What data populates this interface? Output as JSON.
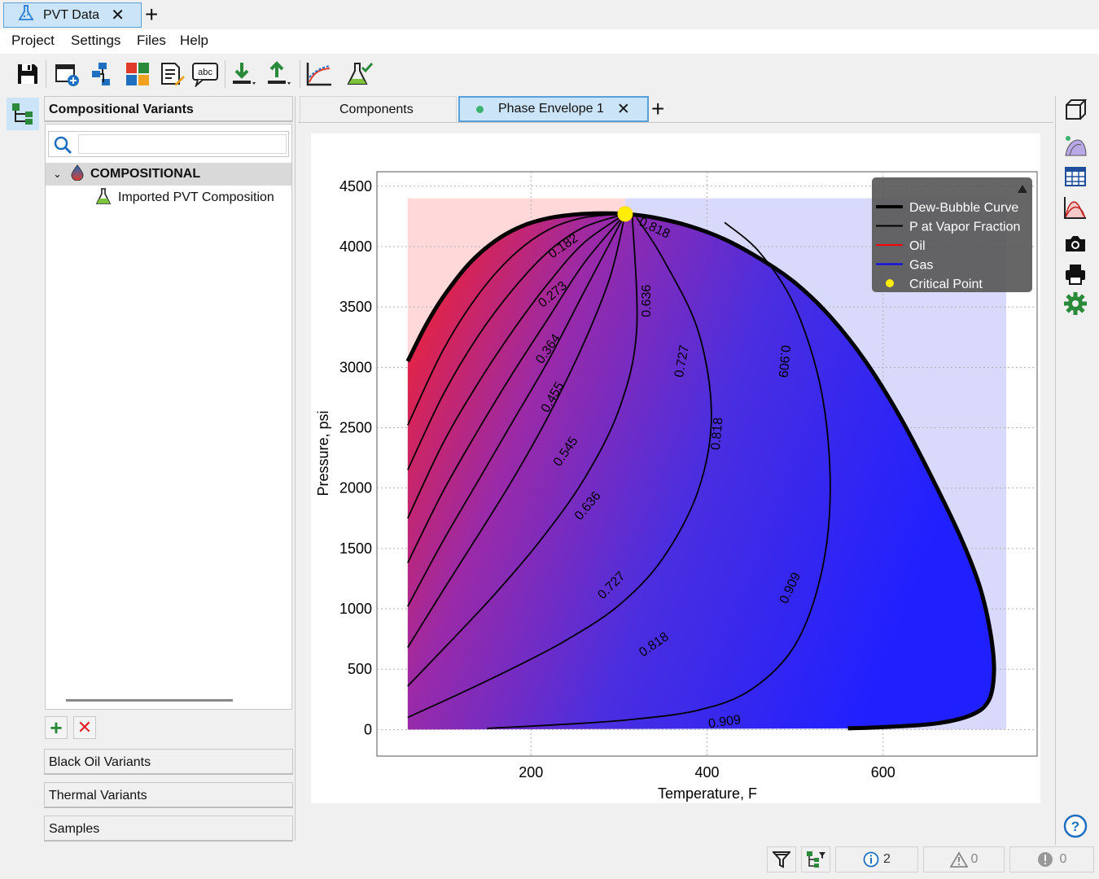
{
  "app_tab": {
    "title": "PVT Data"
  },
  "menu": {
    "items": [
      "Project",
      "Settings",
      "Files",
      "Help"
    ]
  },
  "toolbar": {
    "icons": [
      "save-icon",
      "new-window-icon",
      "hierarchy-icon",
      "puzzle-icon",
      "edit-document-icon",
      "spellcheck-icon",
      "import-icon",
      "export-icon",
      "chart-icon",
      "flask-check-icon"
    ],
    "spell_label": "abc"
  },
  "left_panel": {
    "title": "Compositional Variants",
    "search": {
      "value": "",
      "placeholder": ""
    },
    "tree": {
      "root": "COMPOSITIONAL",
      "children": [
        "Imported PVT Composition"
      ]
    },
    "sections": [
      "Black Oil Variants",
      "Thermal Variants",
      "Samples"
    ]
  },
  "doc_tabs": [
    {
      "label": "Components",
      "active": false
    },
    {
      "label": "Phase Envelope 1",
      "active": true
    }
  ],
  "chart_data": {
    "type": "line",
    "title": "",
    "xlabel": "Temperature, F",
    "ylabel": "Pressure, psi",
    "xlim": [
      25,
      775
    ],
    "ylim": [
      -220,
      4620
    ],
    "xticks": [
      200,
      400,
      600
    ],
    "yticks": [
      0,
      500,
      1000,
      1500,
      2000,
      2500,
      3000,
      3500,
      4000,
      4500
    ],
    "grid": true,
    "legend_position": "top-right",
    "legend": [
      {
        "label": "Dew-Bubble Curve",
        "color": "#000000",
        "kind": "thick-line"
      },
      {
        "label": "P at Vapor Fraction",
        "color": "#000000",
        "kind": "line"
      },
      {
        "label": "Oil",
        "color": "#ff0000",
        "kind": "line"
      },
      {
        "label": "Gas",
        "color": "#0000ff",
        "kind": "line"
      },
      {
        "label": "Critical Point",
        "color": "#ffee00",
        "kind": "marker"
      }
    ],
    "region_fill": {
      "oil": "#ffd9d9",
      "gas": "#d9d9fb",
      "t_min": 60,
      "t_max": 740,
      "p_max": 4400
    },
    "critical_point": {
      "T": 307,
      "P": 4270
    },
    "envelope": [
      [
        60,
        3050
      ],
      [
        80,
        3340
      ],
      [
        100,
        3580
      ],
      [
        130,
        3860
      ],
      [
        160,
        4050
      ],
      [
        190,
        4170
      ],
      [
        220,
        4235
      ],
      [
        250,
        4265
      ],
      [
        280,
        4275
      ],
      [
        307,
        4270
      ],
      [
        340,
        4240
      ],
      [
        380,
        4170
      ],
      [
        420,
        4060
      ],
      [
        460,
        3900
      ],
      [
        500,
        3700
      ],
      [
        540,
        3420
      ],
      [
        580,
        3050
      ],
      [
        620,
        2580
      ],
      [
        660,
        2020
      ],
      [
        690,
        1560
      ],
      [
        710,
        1180
      ],
      [
        722,
        800
      ],
      [
        726,
        480
      ],
      [
        720,
        240
      ],
      [
        700,
        120
      ],
      [
        660,
        50
      ],
      [
        600,
        20
      ],
      [
        560,
        10
      ]
    ],
    "quality_lines": [
      {
        "label": "0.182",
        "label_T": 237,
        "label_P": 4000,
        "points": [
          [
            60,
            2520
          ],
          [
            100,
            3140
          ],
          [
            140,
            3600
          ],
          [
            180,
            3930
          ],
          [
            220,
            4140
          ],
          [
            260,
            4240
          ],
          [
            307,
            4270
          ]
        ]
      },
      {
        "label": "0.273",
        "label_T": 225,
        "label_P": 3600,
        "points": [
          [
            60,
            2150
          ],
          [
            100,
            2770
          ],
          [
            140,
            3260
          ],
          [
            180,
            3650
          ],
          [
            220,
            3960
          ],
          [
            260,
            4160
          ],
          [
            307,
            4270
          ]
        ]
      },
      {
        "label": "0.364",
        "label_T": 220,
        "label_P": 3150,
        "points": [
          [
            60,
            1750
          ],
          [
            100,
            2370
          ],
          [
            140,
            2870
          ],
          [
            180,
            3310
          ],
          [
            220,
            3700
          ],
          [
            260,
            4030
          ],
          [
            307,
            4270
          ]
        ]
      },
      {
        "label": "0.455",
        "label_T": 225,
        "label_P": 2750,
        "points": [
          [
            60,
            1380
          ],
          [
            100,
            1970
          ],
          [
            140,
            2480
          ],
          [
            180,
            2960
          ],
          [
            220,
            3410
          ],
          [
            260,
            3860
          ],
          [
            307,
            4270
          ]
        ]
      },
      {
        "label": "0.545",
        "label_T": 240,
        "label_P": 2300,
        "points": [
          [
            60,
            1020
          ],
          [
            100,
            1560
          ],
          [
            140,
            2060
          ],
          [
            180,
            2560
          ],
          [
            220,
            3060
          ],
          [
            260,
            3620
          ],
          [
            307,
            4270
          ]
        ]
      },
      {
        "label": "0.636",
        "label_T": 265,
        "label_P": 1850,
        "points": [
          [
            60,
            680
          ],
          [
            100,
            1150
          ],
          [
            140,
            1610
          ],
          [
            180,
            2080
          ],
          [
            220,
            2600
          ],
          [
            260,
            3200
          ],
          [
            290,
            3750
          ],
          [
            307,
            4270
          ]
        ]
      },
      {
        "label": "0.727",
        "label_T": 292,
        "label_P": 1190,
        "points": [
          [
            60,
            360
          ],
          [
            110,
            740
          ],
          [
            160,
            1130
          ],
          [
            210,
            1560
          ],
          [
            260,
            2070
          ],
          [
            300,
            2650
          ],
          [
            320,
            3300
          ],
          [
            315,
            4270
          ]
        ]
      },
      {
        "label": "0.818",
        "label_T": 340,
        "label_P": 700,
        "points": [
          [
            60,
            100
          ],
          [
            120,
            300
          ],
          [
            180,
            510
          ],
          [
            240,
            740
          ],
          [
            300,
            1030
          ],
          [
            350,
            1420
          ],
          [
            390,
            1980
          ],
          [
            405,
            2600
          ],
          [
            390,
            3300
          ],
          [
            350,
            3900
          ],
          [
            320,
            4240
          ]
        ]
      },
      {
        "label": "0.909",
        "label_T": 420,
        "label_P": 60,
        "points": [
          [
            150,
            10
          ],
          [
            230,
            40
          ],
          [
            310,
            80
          ],
          [
            390,
            160
          ],
          [
            450,
            330
          ],
          [
            500,
            700
          ],
          [
            530,
            1300
          ],
          [
            540,
            2000
          ],
          [
            530,
            2800
          ],
          [
            500,
            3500
          ],
          [
            460,
            3950
          ],
          [
            420,
            4200
          ]
        ]
      }
    ],
    "extra_labels": [
      {
        "text": "0.818",
        "T": 340,
        "P": 4150,
        "angle": 25
      },
      {
        "text": "0.636",
        "T": 332,
        "P": 3550,
        "angle": -90
      },
      {
        "text": "0.727",
        "T": 372,
        "P": 3050,
        "angle": -80
      },
      {
        "text": "0.818",
        "T": 412,
        "P": 2450,
        "angle": -85
      },
      {
        "text": "0.909",
        "T": 487,
        "P": 3050,
        "angle": 95
      },
      {
        "text": "0.909",
        "T": 495,
        "P": 1170,
        "angle": -65
      }
    ]
  },
  "right_strip": {
    "icons": [
      "cube-icon",
      "phase-diagram-icon",
      "table-icon",
      "curves-icon",
      "camera-icon",
      "print-icon",
      "settings-icon",
      "help-icon"
    ]
  },
  "status": {
    "info_count": "2",
    "warning_count": "0",
    "error_count": "0"
  }
}
